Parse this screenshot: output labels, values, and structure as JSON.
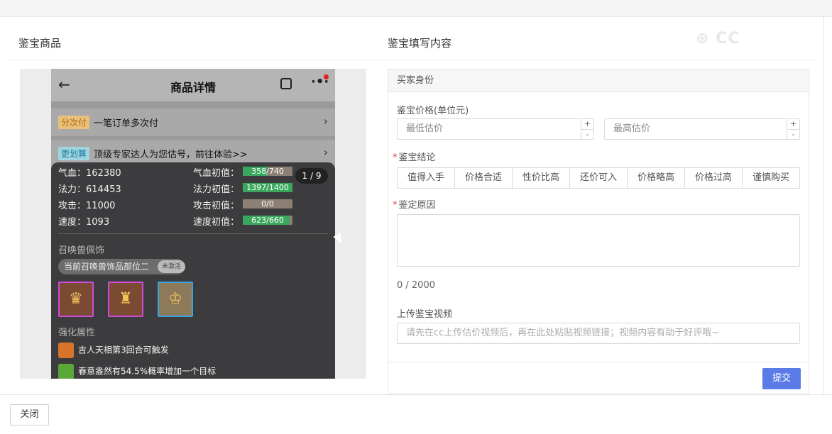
{
  "left_section": {
    "title": "鉴宝商品"
  },
  "right_section": {
    "title": "鉴宝填写内容"
  },
  "watermark": "CC",
  "phone": {
    "header": {
      "title": "商品详情",
      "back_icon": "arrow-left-icon",
      "share_icon": "share-icon",
      "more_icon": "more-icon"
    },
    "rows": [
      {
        "tag": "分次付",
        "text": "一笔订单多次付",
        "tag_color": "#e8a84a"
      },
      {
        "tag": "更划算",
        "text": "顶级专家达人为您估号，前往体验>>",
        "tag_color": "#4aa5c8"
      }
    ],
    "counter": "1 / 9",
    "stats": {
      "hp_label": "气血：162380",
      "mp_label": "法力：614453",
      "atk_label": "攻击：11000",
      "spd_label": "速度：1093",
      "hp_init_label": "气血初值：",
      "mp_init_label": "法力初值：",
      "atk_init_label": "攻击初值：",
      "spd_init_label": "速度初值：",
      "hp_init": {
        "text": "358/740",
        "fraction": 0.484
      },
      "mp_init": {
        "text": "1397/1400",
        "fraction": 0.998
      },
      "atk_init": {
        "text": "0/0",
        "fraction": 0
      },
      "spd_init": {
        "text": "623/660",
        "fraction": 0.944
      }
    },
    "ornament_title": "召唤兽佩饰",
    "ornament_pill": "当前召唤兽饰品部位二",
    "ornament_badge": "未激活",
    "enhance_title": "强化属性",
    "skills": [
      {
        "text": "吉人天相第3回合可触发",
        "color": "#d8742a"
      },
      {
        "text": "春意盎然有54.5%概率增加一个目标",
        "color": "#5aa83a"
      }
    ]
  },
  "form": {
    "card_head": "买家身份",
    "price_label": "鉴宝价格(单位元)",
    "min_placeholder": "最低估价",
    "max_placeholder": "最高估价",
    "stepper_up": "+",
    "stepper_down": "-",
    "conclusion_label": "鉴宝结论",
    "conclusion_options": [
      "值得入手",
      "价格合适",
      "性价比高",
      "还价可入",
      "价格略高",
      "价格过高",
      "谨慎购买"
    ],
    "reason_label": "鉴定原因",
    "reason_count": "0 / 2000",
    "video_label": "上传鉴宝视频",
    "video_placeholder": "请先在cc上传估价视频后，再在此处粘贴视频链接；视频内容有助于好评哦~",
    "required_mark": "*",
    "submit_label": "提交"
  },
  "footer": {
    "close_label": "关闭"
  }
}
